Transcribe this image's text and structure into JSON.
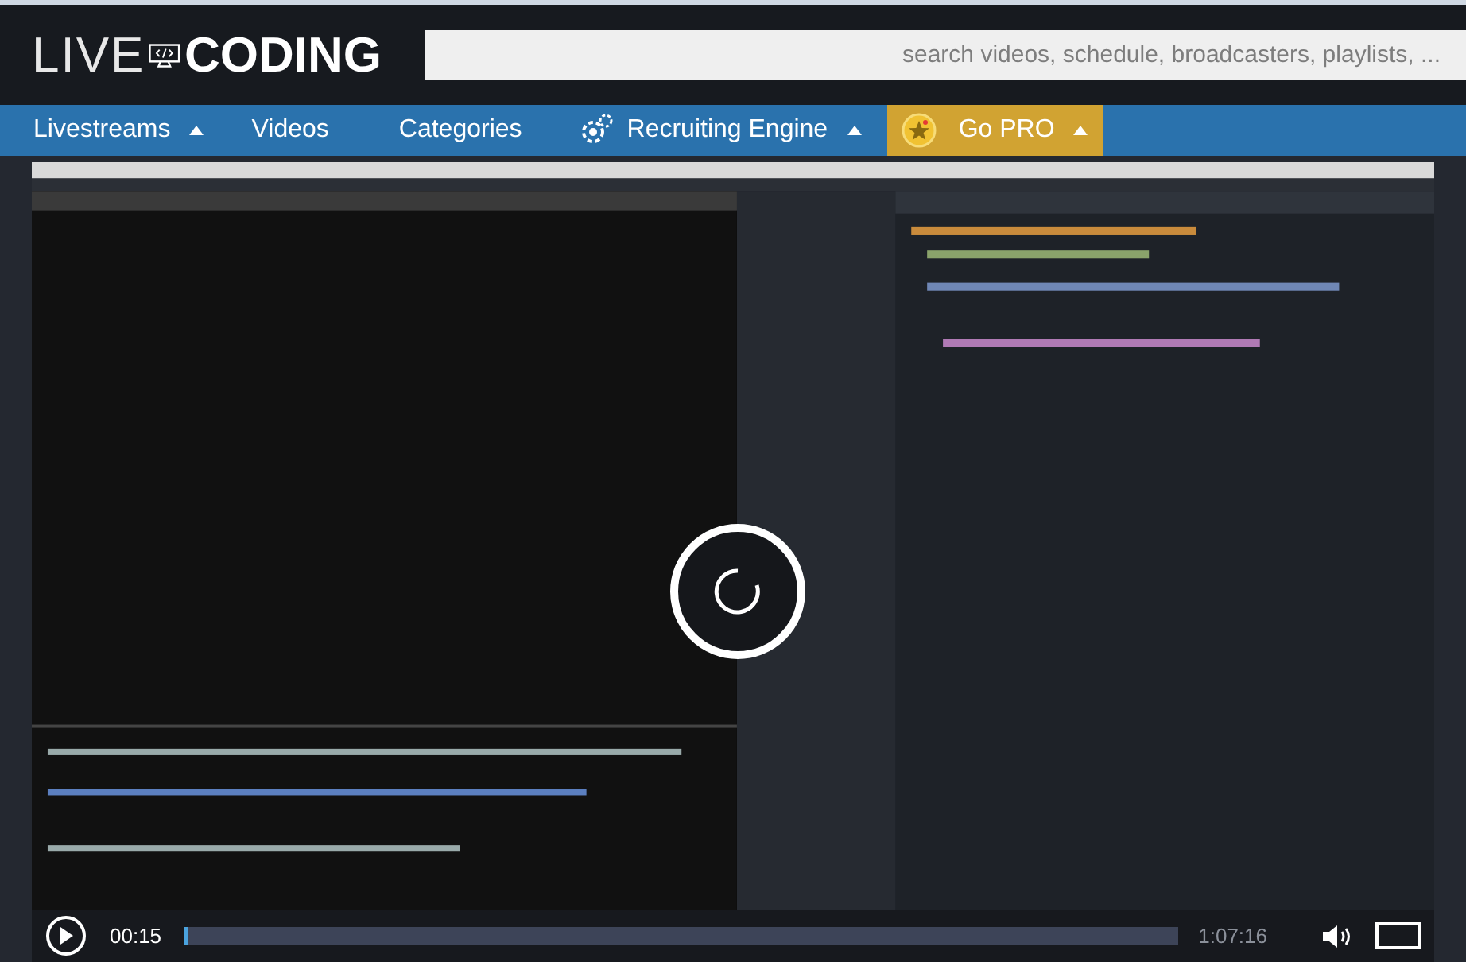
{
  "logo": {
    "light": "LIVE",
    "bold": "CODING"
  },
  "search": {
    "placeholder": "search videos, schedule, broadcasters, playlists, ..."
  },
  "nav": [
    {
      "label": "Livestreams",
      "kind": "dropdown"
    },
    {
      "label": "Videos",
      "kind": "link"
    },
    {
      "label": "Categories",
      "kind": "link"
    },
    {
      "label": "Recruiting Engine",
      "kind": "icon-dropdown"
    },
    {
      "label": "Go PRO",
      "kind": "pro"
    }
  ],
  "video": {
    "kind": "picture",
    "loading": true
  },
  "player": {
    "elapsed": "00:15",
    "level": 0.003,
    "duration": "1:07:16"
  }
}
